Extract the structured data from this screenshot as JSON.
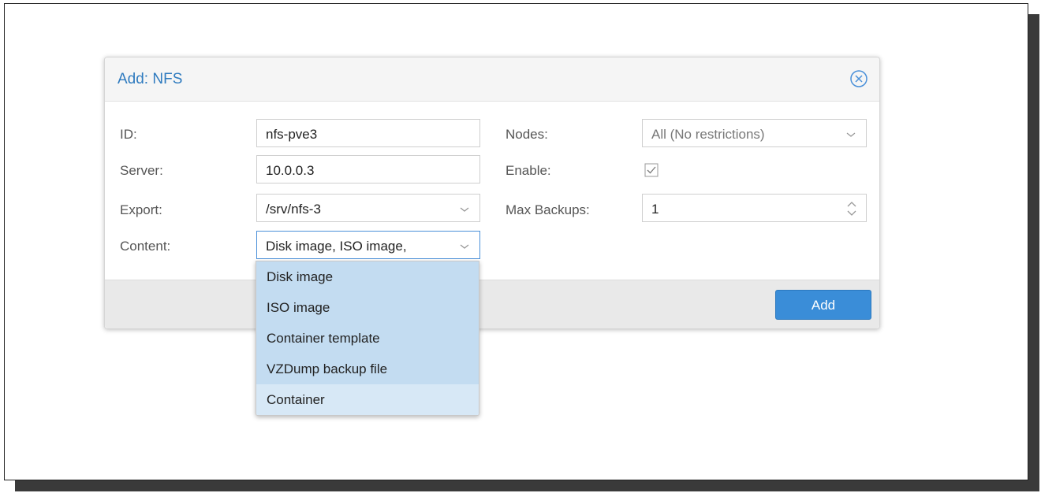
{
  "dialog": {
    "title": "Add: NFS",
    "close_icon": "circle-x-icon"
  },
  "form": {
    "id": {
      "label": "ID:",
      "value": "nfs-pve3"
    },
    "server": {
      "label": "Server:",
      "value": "10.0.0.3"
    },
    "export": {
      "label": "Export:",
      "value": "/srv/nfs-3"
    },
    "content": {
      "label": "Content:",
      "value": "Disk image, ISO image, "
    },
    "nodes": {
      "label": "Nodes:",
      "value": "All (No restrictions)"
    },
    "enable": {
      "label": "Enable:",
      "checked": true
    },
    "max_backups": {
      "label": "Max Backups:",
      "value": "1"
    }
  },
  "footer": {
    "add_label": "Add"
  },
  "content_dropdown": {
    "items": [
      {
        "label": "Disk image",
        "selected": true
      },
      {
        "label": "ISO image",
        "selected": true
      },
      {
        "label": "Container template",
        "selected": true
      },
      {
        "label": "VZDump backup file",
        "selected": true
      },
      {
        "label": "Container",
        "selected": false
      }
    ]
  },
  "colors": {
    "accent": "#3a8dd8",
    "title": "#2f7bbf",
    "selected_item": "#c3dcf1",
    "hover_item": "#d7e8f6"
  }
}
